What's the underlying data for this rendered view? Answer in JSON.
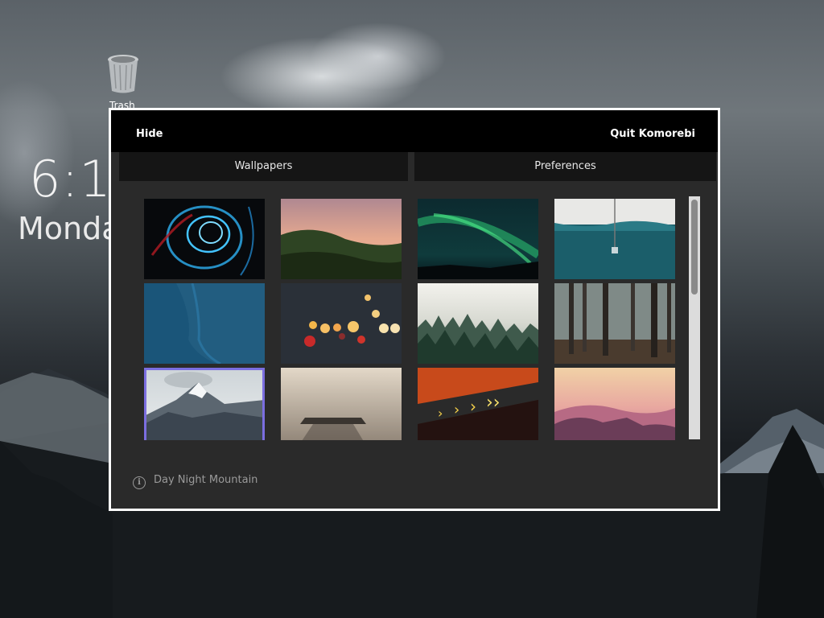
{
  "desktop": {
    "trash_label": "Trash",
    "clock_time": "6:1",
    "clock_day": "Monda"
  },
  "window": {
    "hide_label": "Hide",
    "quit_label": "Quit Komorebi",
    "tabs": [
      {
        "label": "Wallpapers"
      },
      {
        "label": "Preferences"
      }
    ],
    "wallpapers": [
      {
        "icon": "blue-light-swirl"
      },
      {
        "icon": "sunset-hills"
      },
      {
        "icon": "aurora-borealis"
      },
      {
        "icon": "teal-water-lamp"
      },
      {
        "icon": "blue-water-surface"
      },
      {
        "icon": "city-bokeh-lights"
      },
      {
        "icon": "foggy-pine-forest"
      },
      {
        "icon": "misty-forest-trunks"
      },
      {
        "icon": "snowy-mountain-peak",
        "selected": true
      },
      {
        "icon": "foggy-pier"
      },
      {
        "icon": "tunnel-arrows"
      },
      {
        "icon": "pink-sunset-mountains"
      }
    ],
    "selected_info": "Day Night Mountain",
    "colors": {
      "selection": "#7b6ee0",
      "window_border": "#ffffff",
      "titlebar": "#000000"
    }
  }
}
